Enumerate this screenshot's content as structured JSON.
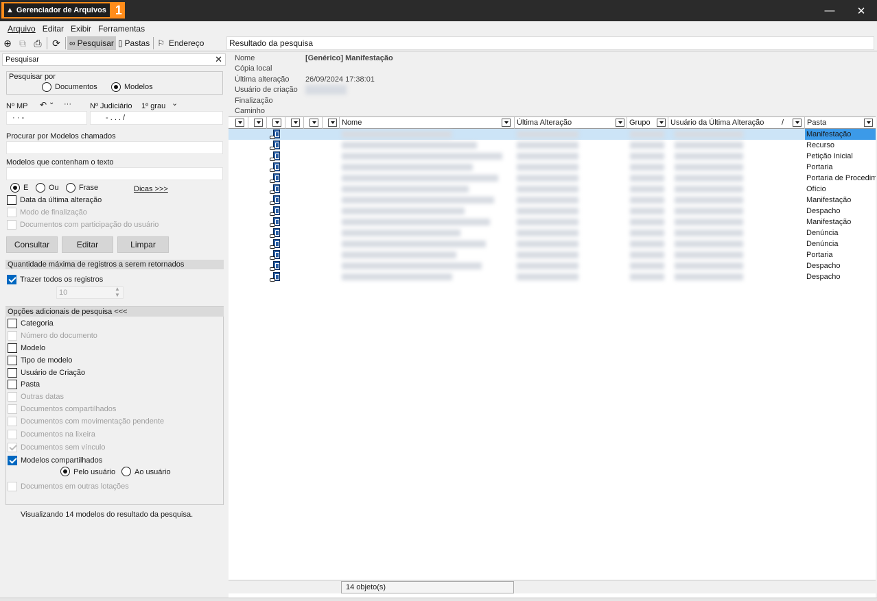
{
  "app": {
    "title": "Gerenciador de Arquivos",
    "badge": "1",
    "minimize": "—",
    "close": "✕"
  },
  "menu": {
    "items": [
      "Arquivo",
      "Editar",
      "Exibir",
      "Ferramentas"
    ],
    "mnemonics": [
      "A",
      "E",
      "E",
      "F"
    ]
  },
  "toolbar": {
    "search_label": "Pesquisar",
    "folders_label": "Pastas",
    "address_label": "Endereço",
    "address_value": "Resultado da pesquisa"
  },
  "search_pane": {
    "title": "Pesquisar",
    "search_by_label": "Pesquisar por",
    "opt_documents": "Documentos",
    "opt_models": "Modelos",
    "selected": "Modelos",
    "mp_label": "Nº MP",
    "mp_dots": "·  ·      -",
    "judicial_label": "Nº Judiciário",
    "judicial_degree": "1º grau",
    "judicial_mask": "-  .  .  .      /",
    "called_label": "Procurar por Modelos chamados",
    "called_value": "",
    "contains_label": "Modelos que contenham o texto",
    "contains_value": "",
    "opt_and": "E",
    "opt_or": "Ou",
    "opt_phrase": "Frase",
    "tips_link": "Dicas >>>",
    "last_change": "Data da última alteração",
    "finalization_mode": "Modo de finalização",
    "user_docs": "Documentos com participação do usuário",
    "btn_consult": "Consultar",
    "btn_edit": "Editar",
    "btn_clear": "Limpar",
    "max_records_label": "Quantidade máxima de registros a serem retornados",
    "bring_all": "Trazer todos os registros",
    "max_value": "10",
    "extra_options_label": "Opções adicionais de pesquisa <<<",
    "extra_options": [
      {
        "label": "Categoria",
        "state": "off"
      },
      {
        "label": "Número do documento",
        "state": "disabled"
      },
      {
        "label": "Modelo",
        "state": "off"
      },
      {
        "label": "Tipo de modelo",
        "state": "off"
      },
      {
        "label": "Usuário de Criação",
        "state": "off"
      },
      {
        "label": "Pasta",
        "state": "off"
      },
      {
        "label": "Outras datas",
        "state": "disabled"
      },
      {
        "label": "Documentos compartilhados",
        "state": "disabled"
      },
      {
        "label": "Documentos com movimentação pendente",
        "state": "disabled"
      },
      {
        "label": "Documentos na lixeira",
        "state": "disabled"
      },
      {
        "label": "Documentos sem vínculo",
        "state": "disabled-checked"
      },
      {
        "label": "Modelos compartilhados",
        "state": "on"
      }
    ],
    "by_user": "Pelo usuário",
    "to_user": "Ao usuário",
    "other_units": "Documentos em outras lotações",
    "status_text": "Visualizando 14 modelos do resultado da pesquisa."
  },
  "details": {
    "name_label": "Nome",
    "name_value": "[Genérico] Manifestação",
    "local_copy_label": "Cópia local",
    "last_change_label": "Última alteração",
    "last_change_value": "26/09/2024 17:38:01",
    "creator_label": "Usuário de criação",
    "finalization_label": "Finalização",
    "path_label": "Caminho"
  },
  "grid": {
    "columns": [
      "Nome",
      "Última Alteração",
      "Grupo",
      "Usuário da Última Alteração",
      "Pasta"
    ],
    "sort_mark": "/",
    "rows": [
      {
        "pasta": "Manifestação",
        "selected": true
      },
      {
        "pasta": "Recurso"
      },
      {
        "pasta": "Petição Inicial"
      },
      {
        "pasta": "Portaria"
      },
      {
        "pasta": "Portaria de Procedimento"
      },
      {
        "pasta": "Ofício"
      },
      {
        "pasta": "Manifestação"
      },
      {
        "pasta": "Despacho"
      },
      {
        "pasta": "Manifestação"
      },
      {
        "pasta": "Denúncia"
      },
      {
        "pasta": "Denúncia"
      },
      {
        "pasta": "Portaria"
      },
      {
        "pasta": "Despacho"
      },
      {
        "pasta": "Despacho"
      }
    ],
    "count_text": "14 objeto(s)"
  },
  "colors": {
    "title_accent": "#ff8c1a",
    "selection": "#cce4f7",
    "selection_strong": "#3c9ae8",
    "check_on": "#0067c0"
  }
}
